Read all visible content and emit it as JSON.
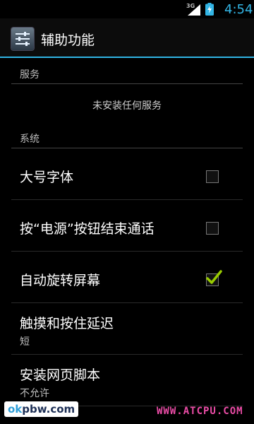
{
  "status_bar": {
    "network": "3G",
    "time": "4:54",
    "icons": [
      "signal-icon",
      "charging-battery-icon"
    ]
  },
  "action_bar": {
    "title": "辅助功能",
    "icon": "accessibility-settings-icon"
  },
  "sections": [
    {
      "header": "服务",
      "empty_message": "未安装任何服务"
    },
    {
      "header": "系统"
    }
  ],
  "items": [
    {
      "title": "大号字体",
      "checked": false
    },
    {
      "title": "按“电源”按钮结束通话",
      "checked": false
    },
    {
      "title": "自动旋转屏幕",
      "checked": true
    },
    {
      "title": "触摸和按住延迟",
      "summary": "短"
    },
    {
      "title": "安装网页脚本",
      "summary": "不允许"
    }
  ],
  "watermark_left": {
    "ok": "ok",
    "rest": "pbw.com"
  },
  "watermark_right": "WWW.ATCPU.COM",
  "colors": {
    "accent": "#33b5e5",
    "check": "#99cc00"
  }
}
